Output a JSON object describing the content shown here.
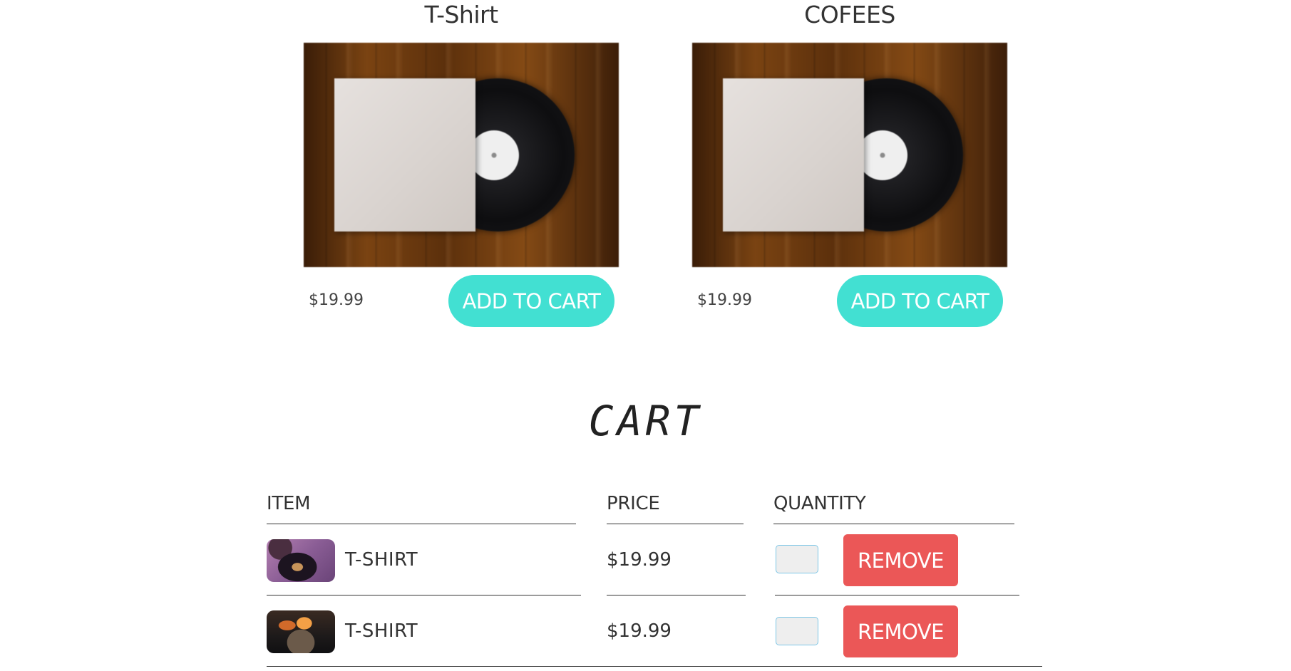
{
  "products": [
    {
      "title": "T-Shirt",
      "price": "$19.99",
      "button_label": "ADD TO CART",
      "image": "vinyl-record-image"
    },
    {
      "title": "COFEES",
      "price": "$19.99",
      "button_label": "ADD TO CART",
      "image": "vinyl-record-image"
    }
  ],
  "cart": {
    "heading": "CART",
    "headers": {
      "item": "ITEM",
      "price": "PRICE",
      "quantity": "QUANTITY"
    },
    "rows": [
      {
        "name": "T-SHIRT",
        "price": "$19.99",
        "quantity": "",
        "remove_label": "REMOVE",
        "thumbnail": "turntable-purple-thumbnail"
      },
      {
        "name": "T-SHIRT",
        "price": "$19.99",
        "quantity": "",
        "remove_label": "REMOVE",
        "thumbnail": "turntable-orange-thumbnail"
      }
    ]
  },
  "colors": {
    "add_to_cart_button": "#42e0d2",
    "remove_button": "#eb5757",
    "text": "#333333",
    "quantity_border": "#7ec7e6"
  }
}
